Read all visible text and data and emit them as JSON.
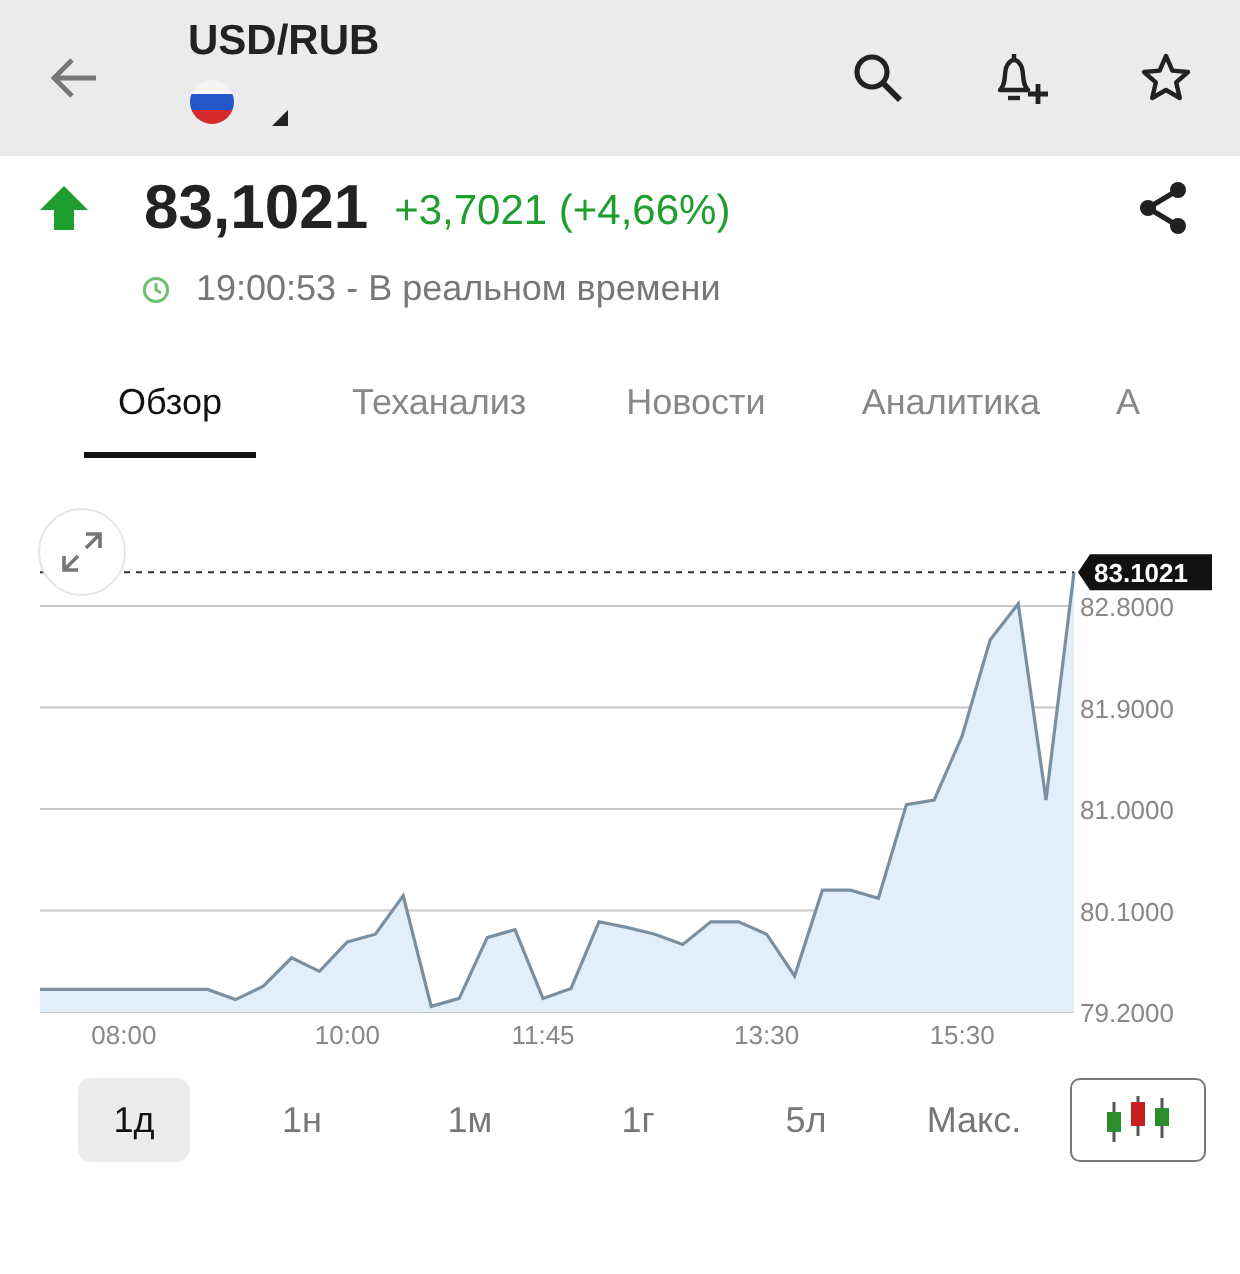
{
  "header": {
    "title": "USD/RUB"
  },
  "quote": {
    "price": "83,1021",
    "change": "+3,7021 (+4,66%)",
    "up": true,
    "time": "19:00:53 - В реальном времени"
  },
  "tabs": [
    {
      "label": "Обзор",
      "selected": true
    },
    {
      "label": "Теханализ",
      "selected": false
    },
    {
      "label": "Новости",
      "selected": false
    },
    {
      "label": "Аналитика",
      "selected": false
    },
    {
      "label": "А",
      "selected": false
    }
  ],
  "chart": {
    "chart_data": {
      "type": "area",
      "grid": true,
      "ref_lines": [
        {
          "label": "83.1021"
        }
      ],
      "ylim": [
        79.2,
        83.1021
      ],
      "categories": [
        null,
        null,
        null,
        "08:00",
        null,
        null,
        null,
        null,
        null,
        null,
        null,
        "10:00",
        null,
        null,
        null,
        null,
        null,
        null,
        "11:45",
        null,
        null,
        null,
        null,
        null,
        null,
        null,
        "13:30",
        null,
        null,
        null,
        null,
        null,
        null,
        "15:30",
        null,
        null,
        null,
        null
      ],
      "series": [
        {
          "color": "#7a8fa0",
          "values": [
            79.4,
            79.4,
            79.4,
            79.4,
            79.4,
            79.4,
            79.4,
            79.31,
            79.43,
            79.68,
            79.56,
            79.82,
            79.89,
            80.23,
            79.25,
            79.32,
            79.86,
            79.93,
            79.32,
            79.41,
            80.0,
            79.95,
            79.89,
            79.8,
            80.0,
            80.0,
            79.89,
            79.52,
            80.28,
            80.28,
            80.21,
            81.04,
            81.08,
            81.65,
            82.5,
            82.82,
            81.08,
            83.1
          ]
        }
      ],
      "yticks": [
        {
          "value": 79.2,
          "label": "79.2000"
        },
        {
          "value": 80.1,
          "label": "80.1000"
        },
        {
          "value": 81.0,
          "label": "81.0000"
        },
        {
          "value": 81.9,
          "label": "81.9000"
        },
        {
          "value": 82.8,
          "label": "82.8000"
        }
      ]
    }
  },
  "ranges": [
    {
      "label": "1д",
      "selected": true
    },
    {
      "label": "1н",
      "selected": false
    },
    {
      "label": "1м",
      "selected": false
    },
    {
      "label": "1г",
      "selected": false
    },
    {
      "label": "5л",
      "selected": false
    },
    {
      "label": "Макс.",
      "selected": false
    }
  ]
}
